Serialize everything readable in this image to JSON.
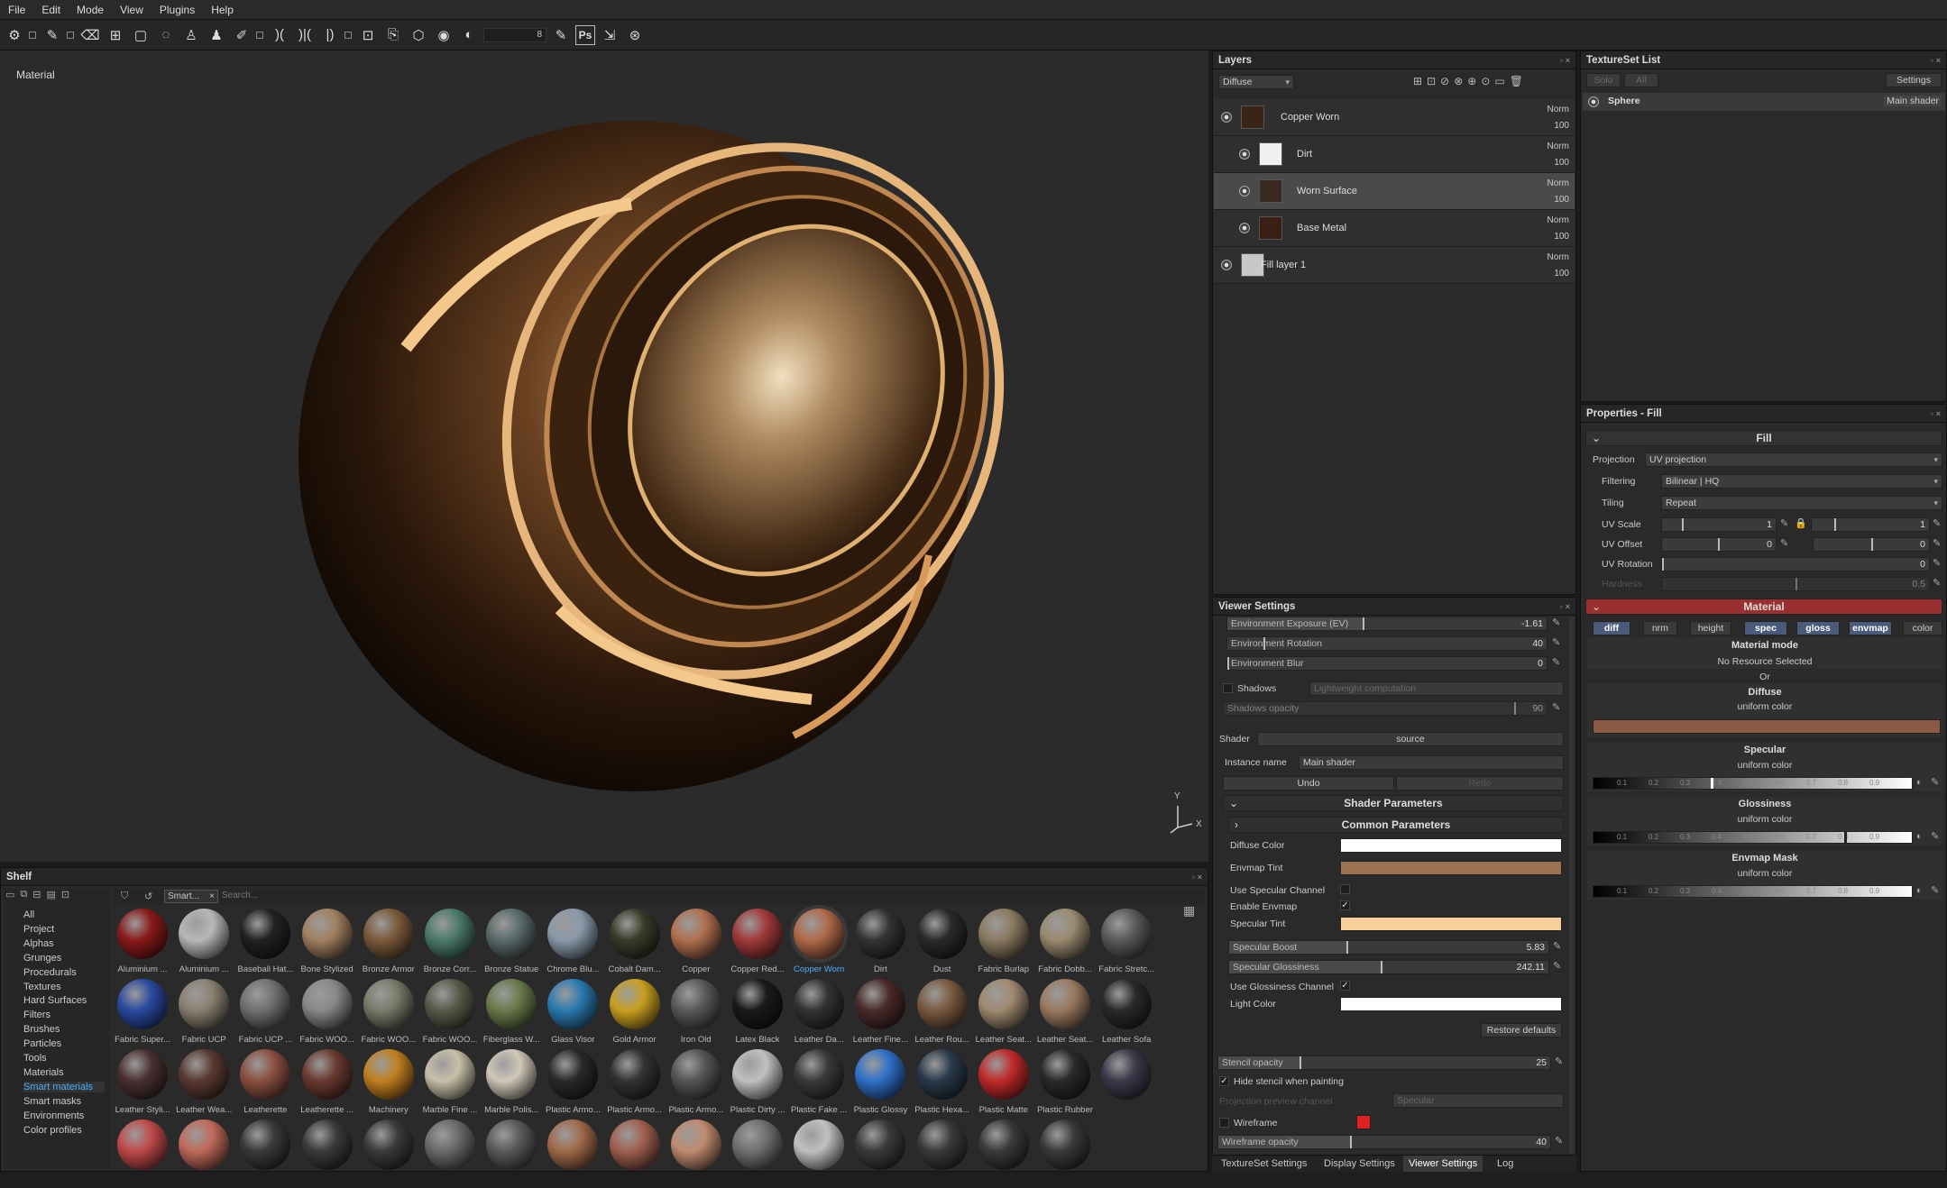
{
  "menu": [
    "File",
    "Edit",
    "Mode",
    "View",
    "Plugins",
    "Help"
  ],
  "toolbar": {
    "brush_size": "8",
    "ps_label": "Ps"
  },
  "viewport": {
    "label": "Material",
    "axis_y": "Y",
    "axis_x": "X"
  },
  "layers": {
    "title": "Layers",
    "channel_select": "Diffuse",
    "items": [
      {
        "name": "Copper Worn",
        "mode": "Norm",
        "opacity": "100"
      },
      {
        "name": "Dirt",
        "mode": "Norm",
        "opacity": "100"
      },
      {
        "name": "Worn Surface",
        "mode": "Norm",
        "opacity": "100"
      },
      {
        "name": "Base Metal",
        "mode": "Norm",
        "opacity": "100"
      },
      {
        "name": "Fill layer 1",
        "mode": "Norm",
        "opacity": "100"
      }
    ]
  },
  "textureset": {
    "title": "TextureSet List",
    "solo": "Solo",
    "all": "All",
    "settings": "Settings",
    "item": "Sphere",
    "shader": "Main shader"
  },
  "properties": {
    "title": "Properties - Fill",
    "section": "Fill",
    "projection_label": "Projection",
    "projection": "UV projection",
    "filtering_label": "Filtering",
    "filtering": "Bilinear | HQ",
    "tiling_label": "Tiling",
    "tiling": "Repeat",
    "uvscale_label": "UV Scale",
    "uvscale1": "1",
    "uvscale2": "1",
    "uvoffset_label": "UV Offset",
    "uvoffset1": "0",
    "uvoffset2": "0",
    "uvrotation_label": "UV Rotation",
    "uvrotation": "0",
    "hardness_label": "Hardness",
    "hardness": "0.5",
    "material_title": "Material",
    "channels": [
      "diff",
      "nrm",
      "height",
      "spec",
      "gloss",
      "envmap",
      "color"
    ],
    "material_mode": "Material mode",
    "no_resource": "No Resource Selected",
    "or": "Or",
    "diffuse": "Diffuse",
    "diffuse_sub": "uniform color",
    "diffuse_color": "#8a5a44",
    "specular": "Specular",
    "specular_sub": "uniform color",
    "glossiness": "Glossiness",
    "glossiness_sub": "uniform color",
    "envmap_mask": "Envmap Mask",
    "envmap_sub": "uniform color",
    "ticks": [
      "0.1",
      "0.2",
      "0.3",
      "0.4",
      "0.5",
      "0.6",
      "0.7",
      "0.8",
      "0.9"
    ]
  },
  "viewer": {
    "title": "Viewer Settings",
    "env_exposure_label": "Environment Exposure (EV)",
    "env_exposure": "-1.61",
    "env_rotation_label": "Environment Rotation",
    "env_rotation": "40",
    "env_blur_label": "Environment Blur",
    "env_blur": "0",
    "shadows_label": "Shadows",
    "shadows_mode": "Lightweight computation",
    "shadows_opacity_label": "Shadows opacity",
    "shadows_opacity": "90",
    "shader_label": "Shader",
    "shader_source": "source",
    "instance_label": "Instance name",
    "instance": "Main shader",
    "undo": "Undo",
    "redo": "Redo",
    "shader_params": "Shader Parameters",
    "common_params": "Common Parameters",
    "diffuse_color_label": "Diffuse Color",
    "envmap_tint_label": "Envmap Tint",
    "use_spec_label": "Use Specular Channel",
    "enable_envmap_label": "Enable Envmap",
    "spec_tint_label": "Specular Tint",
    "spec_boost_label": "Specular Boost",
    "spec_boost": "5.83",
    "spec_gloss_label": "Specular Glossiness",
    "spec_gloss": "242.11",
    "use_gloss_label": "Use Glossiness Channel",
    "light_color_label": "Light Color",
    "restore": "Restore defaults",
    "stencil_opacity_label": "Stencil opacity",
    "stencil_opacity": "25",
    "hide_stencil_label": "Hide stencil when painting",
    "projection_preview_label": "Projection preview channel",
    "projection_preview": "Specular",
    "wireframe_label": "Wireframe",
    "wireframe_opacity_label": "Wireframe opacity",
    "wireframe_opacity": "40",
    "colors": {
      "diffuse": "#ffffff",
      "envmap_tint": "#9c7352",
      "spec_tint": "#f7cf9a",
      "light": "#ffffff",
      "wire": "#e02020"
    }
  },
  "bottom_tabs": [
    "TextureSet Settings",
    "Display Settings",
    "Viewer Settings",
    "Log"
  ],
  "shelf": {
    "title": "Shelf",
    "filter_tag": "Smart...",
    "search_placeholder": "Search...",
    "categories": [
      "All",
      "Project",
      "Alphas",
      "Grunges",
      "Procedurals",
      "Textures",
      "Hard Surfaces",
      "Filters",
      "Brushes",
      "Particles",
      "Tools",
      "Materials",
      "Smart materials",
      "Smart masks",
      "Environments",
      "Color profiles"
    ],
    "selected_category": "Smart materials",
    "materials": [
      "Aluminium ...",
      "Aluminium ...",
      "Baseball Hat...",
      "Bone Stylized",
      "Bronze Armor",
      "Bronze Corr...",
      "Bronze Statue",
      "Chrome Blu...",
      "Cobalt Dam...",
      "Copper",
      "Copper Red...",
      "Copper Worn",
      "Dirt",
      "Dust",
      "Fabric Burlap",
      "Fabric Dobb...",
      "Fabric Stretc...",
      "Fabric Super...",
      "Fabric UCP",
      "Fabric UCP ...",
      "Fabric WOO...",
      "Fabric WOO...",
      "Fabric WOO...",
      "Fiberglass W...",
      "Glass Visor",
      "Gold Armor",
      "Iron Old",
      "Latex Black",
      "Leather Da...",
      "Leather Fine...",
      "Leather Rou...",
      "Leather Seat...",
      "Leather Seat...",
      "Leather Sofa",
      "Leather Styli...",
      "Leather Wea...",
      "Leatherette",
      "Leatherette ...",
      "Machinery",
      "Marble Fine ...",
      "Marble Polis...",
      "Plastic Armo...",
      "Plastic Armo...",
      "Plastic Armo...",
      "Plastic Dirty ...",
      "Plastic Fake ...",
      "Plastic Glossy",
      "Plastic Hexa...",
      "Plastic Matte",
      "Plastic Rubber"
    ]
  }
}
